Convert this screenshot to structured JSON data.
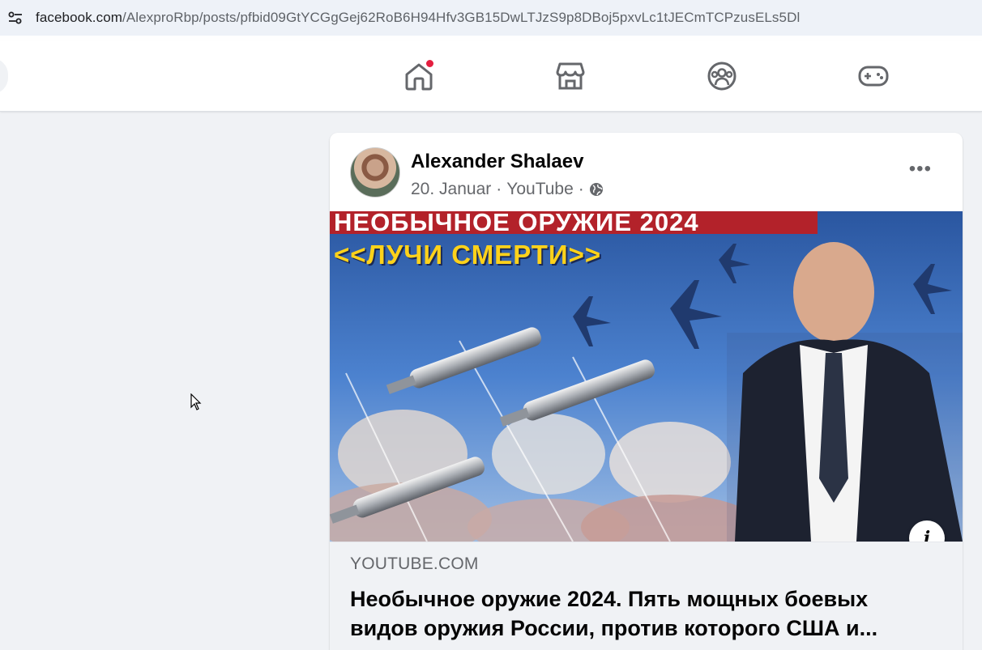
{
  "browser": {
    "url_domain": "facebook.com",
    "url_path": "/AlexproRbp/posts/pfbid09GtYCGgGej62RoB6H94Hfv3GB15DwLTJzS9p8DBoj5pxvLc1tJECmTCPzusELs5Dl",
    "site_info_icon": "tune-icon"
  },
  "nav": {
    "items": [
      {
        "name": "home",
        "icon": "home-icon",
        "has_notification_dot": true
      },
      {
        "name": "marketplace",
        "icon": "store-icon"
      },
      {
        "name": "groups",
        "icon": "groups-icon"
      },
      {
        "name": "gaming",
        "icon": "gamepad-icon"
      }
    ]
  },
  "post": {
    "author": "Alexander Shalaev",
    "date": "20. Januar",
    "source": "YouTube",
    "separator": "·",
    "audience_icon": "globe-icon",
    "more_label": "•••",
    "link": {
      "image_banner_line1": "НЕОБЫЧНОЕ ОРУЖИЕ 2024",
      "image_banner_line2": "<<ЛУЧИ СМЕРТИ>>",
      "domain": "YOUTUBE.COM",
      "title": "Необычное оружие 2024. Пять мощных боевых видов оружия России, против которого США и..."
    },
    "info_label": "i"
  },
  "colors": {
    "fb_bg": "#f0f2f5",
    "notification": "#e41e3f",
    "banner_red": "#b3222a",
    "banner_yellow": "#ffd21a"
  }
}
